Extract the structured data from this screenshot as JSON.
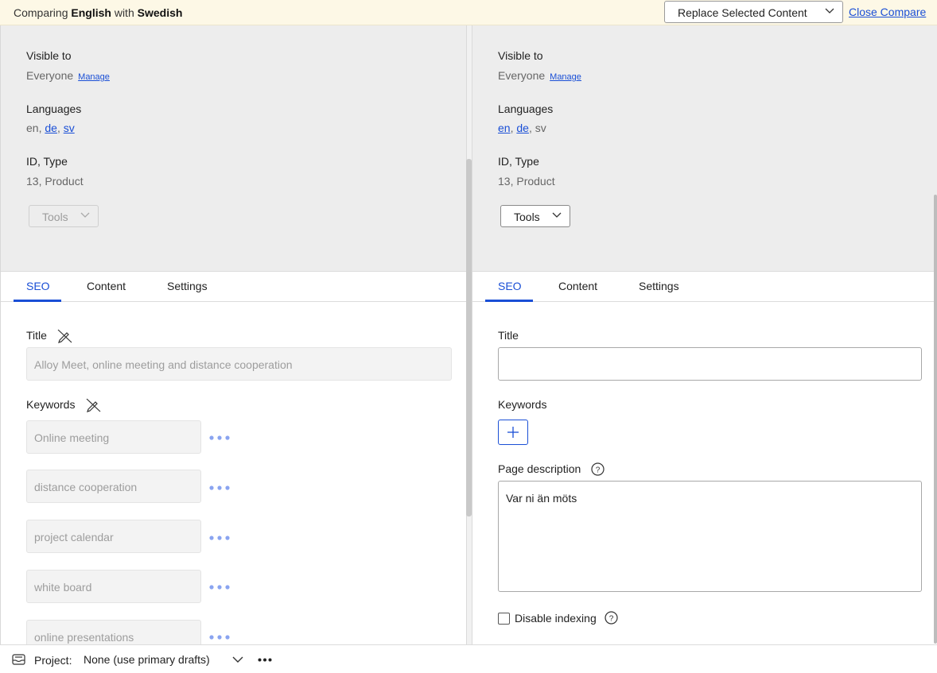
{
  "compare_bar": {
    "prefix": "Comparing",
    "source_language": "English",
    "connector": "with",
    "target_language": "Swedish",
    "replace_select_value": "Replace Selected Content",
    "close_compare_label": "Close Compare"
  },
  "left_pane": {
    "visible_to_label": "Visible to",
    "visible_to_value": "Everyone",
    "manage_label": "Manage",
    "languages_label": "Languages",
    "languages": {
      "first": "en",
      "sep1": ", ",
      "second": "de",
      "sep2": ", ",
      "third": "sv"
    },
    "id_type_label": "ID, Type",
    "id_type_value": "13, Product",
    "tools_label": "Tools",
    "tabs": [
      "SEO",
      "Content",
      "Settings"
    ],
    "title_label": "Title",
    "title_value": "Alloy Meet, online meeting and distance cooperation",
    "keywords_label": "Keywords",
    "keywords": [
      "Online meeting",
      "distance cooperation",
      "project calendar",
      "white board",
      "online presentations"
    ]
  },
  "right_pane": {
    "visible_to_label": "Visible to",
    "visible_to_value": "Everyone",
    "manage_label": "Manage",
    "languages_label": "Languages",
    "languages": {
      "first": "en",
      "sep1": ", ",
      "second": "de",
      "sep2": ", ",
      "third": "sv"
    },
    "id_type_label": "ID, Type",
    "id_type_value": "13, Product",
    "tools_label": "Tools",
    "tabs": [
      "SEO",
      "Content",
      "Settings"
    ],
    "title_label": "Title",
    "title_value": "",
    "keywords_label": "Keywords",
    "page_description_label": "Page description",
    "page_description_value": "Var ni än möts",
    "disable_indexing_label": "Disable indexing"
  },
  "bottom_bar": {
    "project_label": "Project:",
    "project_value": "None (use primary drafts)"
  },
  "colors": {
    "accent": "#1a4fd6",
    "compare_bar_bg": "#fdf8e6",
    "meta_bg": "#ededed",
    "keyword_dots": "#8aa4f0"
  },
  "icons": [
    "chevron-down-icon",
    "no-edit-icon",
    "more-dots-icon",
    "plus-icon",
    "help-icon",
    "project-tray-icon"
  ]
}
